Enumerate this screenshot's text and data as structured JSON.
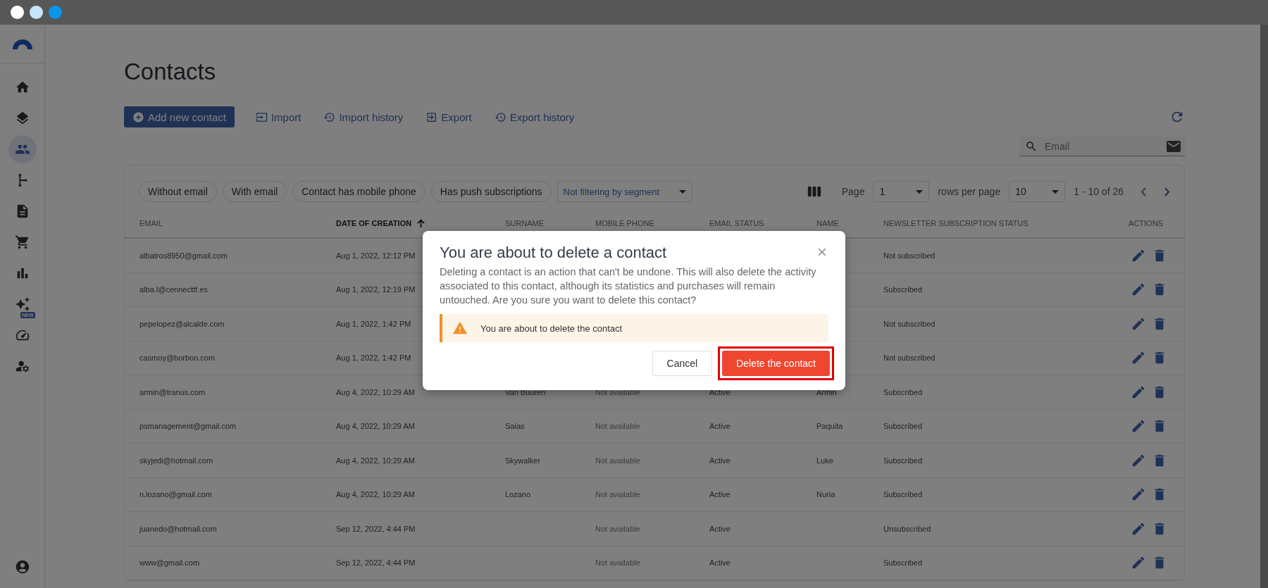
{
  "sidebar": {
    "items": [
      {
        "kind": "home",
        "selected": false
      },
      {
        "kind": "layers",
        "selected": false
      },
      {
        "kind": "people",
        "selected": true
      },
      {
        "kind": "branch",
        "selected": false
      },
      {
        "kind": "document",
        "selected": false
      },
      {
        "kind": "cart",
        "selected": false
      },
      {
        "kind": "chart",
        "selected": false
      },
      {
        "kind": "sparkles",
        "selected": false,
        "badge": "NEW"
      },
      {
        "kind": "gauge",
        "selected": false
      },
      {
        "kind": "user-settings",
        "selected": false
      }
    ],
    "footer": {
      "kind": "account"
    }
  },
  "page": {
    "title": "Contacts"
  },
  "toolbar": {
    "buttons": [
      {
        "kind": "primary",
        "label": "Add new contact"
      },
      {
        "kind": "link",
        "label": "Import"
      },
      {
        "kind": "link",
        "label": "Import history"
      },
      {
        "kind": "link",
        "label": "Export"
      },
      {
        "kind": "link",
        "label": "Export history"
      }
    ]
  },
  "search": {
    "placeholder": "Email"
  },
  "filters": {
    "chips": [
      "Without email",
      "With email",
      "Contact has mobile phone",
      "Has push subscriptions"
    ],
    "segment": "Not filtering by segment"
  },
  "pagination": {
    "page_label": "Page",
    "page": "1",
    "rows_label": "rows per page",
    "rows": "10",
    "range": "1 - 10 of 26",
    "prev": {
      "disabled": true
    },
    "next": {
      "disabled": false
    }
  },
  "table": {
    "columns": [
      {
        "label": "EMAIL",
        "sorted": false
      },
      {
        "label": "DATE OF CREATION",
        "sorted": true
      },
      {
        "label": "SURNAME",
        "sorted": false
      },
      {
        "label": "MOBILE PHONE",
        "sorted": false
      },
      {
        "label": "EMAIL STATUS",
        "sorted": false
      },
      {
        "label": "NAME",
        "sorted": false
      },
      {
        "label": "NEWSLETTER SUBSCRIPTION STATUS",
        "sorted": false
      },
      {
        "label": "ACTIONS",
        "sorted": false
      }
    ],
    "rows": [
      {
        "email": "albatros8950@gmail.com",
        "date": "Aug 1, 2022, 12:12 PM",
        "newsletter": "Not subscribed"
      },
      {
        "email": "alba.l@cennecttf.es",
        "date": "Aug 1, 2022, 12:19 PM",
        "newsletter": "Subscribed"
      },
      {
        "email": "pepelopez@alcalde.com",
        "date": "Aug 1, 2022, 1:42 PM",
        "newsletter": "Not subscribed"
      },
      {
        "email": "casmoy@borbon.com",
        "date": "Aug 1, 2022, 1:42 PM",
        "newsletter": "Not subscribed"
      },
      {
        "email": "armin@tranus.com",
        "date": "Aug 4, 2022, 10:29 AM",
        "surname": "Van Buuren",
        "mobile": "Not available",
        "status": "Active",
        "name": "Armin",
        "newsletter": "Subscribed"
      },
      {
        "email": "psmanagement@gmail.com",
        "date": "Aug 4, 2022, 10:29 AM",
        "surname": "Salas",
        "mobile": "Not available",
        "status": "Active",
        "name": "Paquita",
        "newsletter": "Subscribed"
      },
      {
        "email": "skyjedi@hotmail.com",
        "date": "Aug 4, 2022, 10:29 AM",
        "surname": "Skywalker",
        "mobile": "Not available",
        "status": "Active",
        "name": "Luke",
        "newsletter": "Subscribed"
      },
      {
        "email": "n.lozano@gmail.com",
        "date": "Aug 4, 2022, 10:29 AM",
        "surname": "Lozano",
        "mobile": "Not available",
        "status": "Active",
        "name": "Nuria",
        "newsletter": "Subscribed"
      },
      {
        "email": "juanedo@hotmail.com",
        "date": "Sep 12, 2022, 4:44 PM",
        "mobile": "Not available",
        "status": "Active",
        "newsletter": "Unsubscribed"
      },
      {
        "email": "www@gmail.com",
        "date": "Sep 12, 2022, 4:44 PM",
        "mobile": "Not available",
        "status": "Active",
        "newsletter": "Subscribed"
      }
    ]
  },
  "dialog": {
    "title": "You are about to delete a contact",
    "body": "Deleting a contact is an action that can't be undone. This will also delete the activity associated to this contact, although its statistics and purchases will remain untouched. Are you sure you want to delete this contact?",
    "alert": {
      "kind": "warning",
      "text": "You are about to delete the contact"
    },
    "buttons": [
      {
        "kind": "secondary",
        "label": "Cancel",
        "highlighted": false
      },
      {
        "kind": "danger",
        "label": "Delete the contact",
        "highlighted": true
      }
    ]
  }
}
